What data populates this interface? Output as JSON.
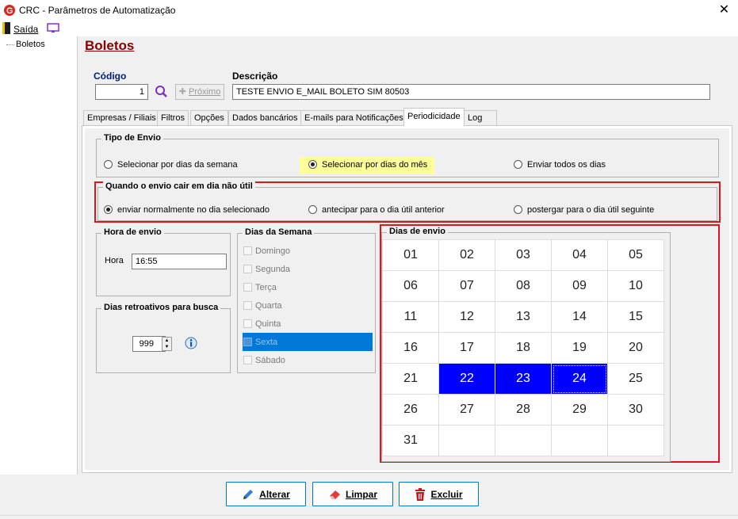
{
  "window": {
    "title": "CRC - Parâmetros de Automatização",
    "close": "✕"
  },
  "menu": {
    "exit_label": "Saída"
  },
  "tree": {
    "item": "Boletos"
  },
  "page": {
    "title": "Boletos"
  },
  "form": {
    "code_label": "Código",
    "code_value": "1",
    "next_label": "Próximo",
    "desc_label": "Descrição",
    "desc_value": "TESTE ENVIO  E_MAIL BOLETO SIM 80503"
  },
  "tabs": [
    "Empresas / Filiais",
    "Filtros",
    "Opções",
    "Dados bancários",
    "E-mails para Notificações",
    "Periodicidade",
    "Log"
  ],
  "active_tab": "Periodicidade",
  "tipo_envio": {
    "title": "Tipo de Envio",
    "options": [
      "Selecionar por dias da semana",
      "Selecionar por dias do mês",
      "Enviar todos os dias"
    ],
    "selected": "Selecionar por dias do mês",
    "highlight_color": "#ffff99"
  },
  "nao_util": {
    "title": "Quando o envio cair em dia não útil",
    "options": [
      "enviar normalmente no dia selecionado",
      "antecipar para o dia útil anterior",
      "postergar para o dia útil seguinte"
    ],
    "selected": "enviar normalmente no dia selecionado"
  },
  "hora": {
    "title": "Hora de envio",
    "label": "Hora",
    "value": "16:55"
  },
  "retro": {
    "title": "Dias retroativos para busca",
    "value": "999"
  },
  "semana": {
    "title": "Dias da Semana",
    "days": [
      "Domingo",
      "Segunda",
      "Terça",
      "Quarta",
      "Quinta",
      "Sexta",
      "Sábado"
    ],
    "highlighted": "Sexta"
  },
  "dias_envio": {
    "title": "Dias de envio",
    "days": [
      "01",
      "02",
      "03",
      "04",
      "05",
      "06",
      "07",
      "08",
      "09",
      "10",
      "11",
      "12",
      "13",
      "14",
      "15",
      "16",
      "17",
      "18",
      "19",
      "20",
      "21",
      "22",
      "23",
      "24",
      "25",
      "26",
      "27",
      "28",
      "29",
      "30",
      "31"
    ],
    "selected": [
      "22",
      "23",
      "24"
    ],
    "focused": "24",
    "selected_color": "#0000ff"
  },
  "buttons": {
    "alterar": "Alterar",
    "limpar": "Limpar",
    "excluir": "Excluir"
  },
  "colors": {
    "accent_title": "#8b0000",
    "red_outline": "#e0151b"
  }
}
